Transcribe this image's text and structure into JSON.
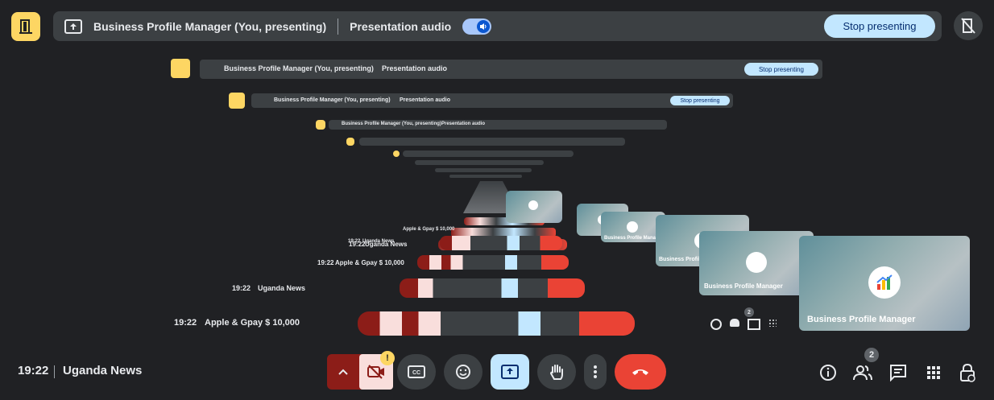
{
  "top_bar": {
    "presenting_label": "Business Profile Manager (You, presenting)",
    "audio_label": "Presentation audio",
    "stop_label": "Stop presenting"
  },
  "mirror": {
    "clock": "19:22",
    "meeting_a": "Uganda News",
    "meeting_b": "Apple & Gpay $ 10,000",
    "participant_name": "Business Profile Manager",
    "participants_count": "2"
  },
  "bottom_bar": {
    "clock": "19:22",
    "meeting_title": "Uganda News",
    "participants_count": "2",
    "badge": "!"
  },
  "colors": {
    "accent_yellow": "#fdd663",
    "stop_blue": "#c2e7ff",
    "end_call_red": "#ea4335",
    "mic_dark_red": "#8c1d18",
    "cam_pink": "#f9dedc"
  },
  "icons": [
    "door-icon",
    "present-icon",
    "speaker-icon",
    "present-off-icon",
    "chevron-up-icon",
    "camera-off-icon",
    "captions-icon",
    "emoji-icon",
    "present-to-all-icon",
    "raise-hand-icon",
    "more-vert-icon",
    "call-end-icon",
    "info-icon",
    "people-icon",
    "chat-icon",
    "apps-icon",
    "lock-icon"
  ]
}
